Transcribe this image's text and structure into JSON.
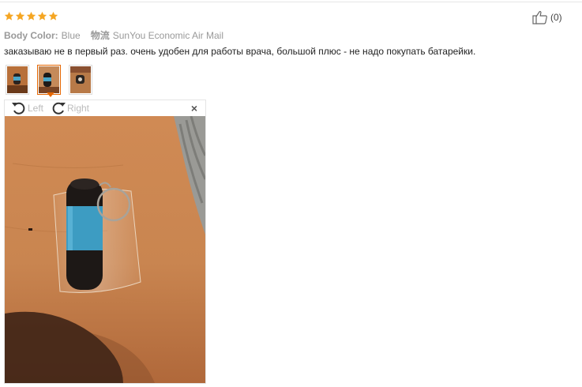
{
  "review": {
    "rating": 5,
    "star_color": "#f5a623",
    "body_color_label": "Body Color:",
    "body_color_value": "Blue",
    "shipping_label": "物流",
    "shipping_value": "SunYou Economic Air Mail",
    "text": "заказываю не в первый раз. очень удобен для работы врача, большой плюс - не надо покупать батарейки.",
    "helpful_count": "(0)"
  },
  "viewer": {
    "rotate_left_label": "Left",
    "rotate_right_label": "Right",
    "close_glyph": "×",
    "accent_color": "#e56600"
  },
  "thumbnails": [
    {
      "name": "thumbnail-1",
      "active": false
    },
    {
      "name": "thumbnail-2",
      "active": true
    },
    {
      "name": "thumbnail-3",
      "active": false
    }
  ]
}
